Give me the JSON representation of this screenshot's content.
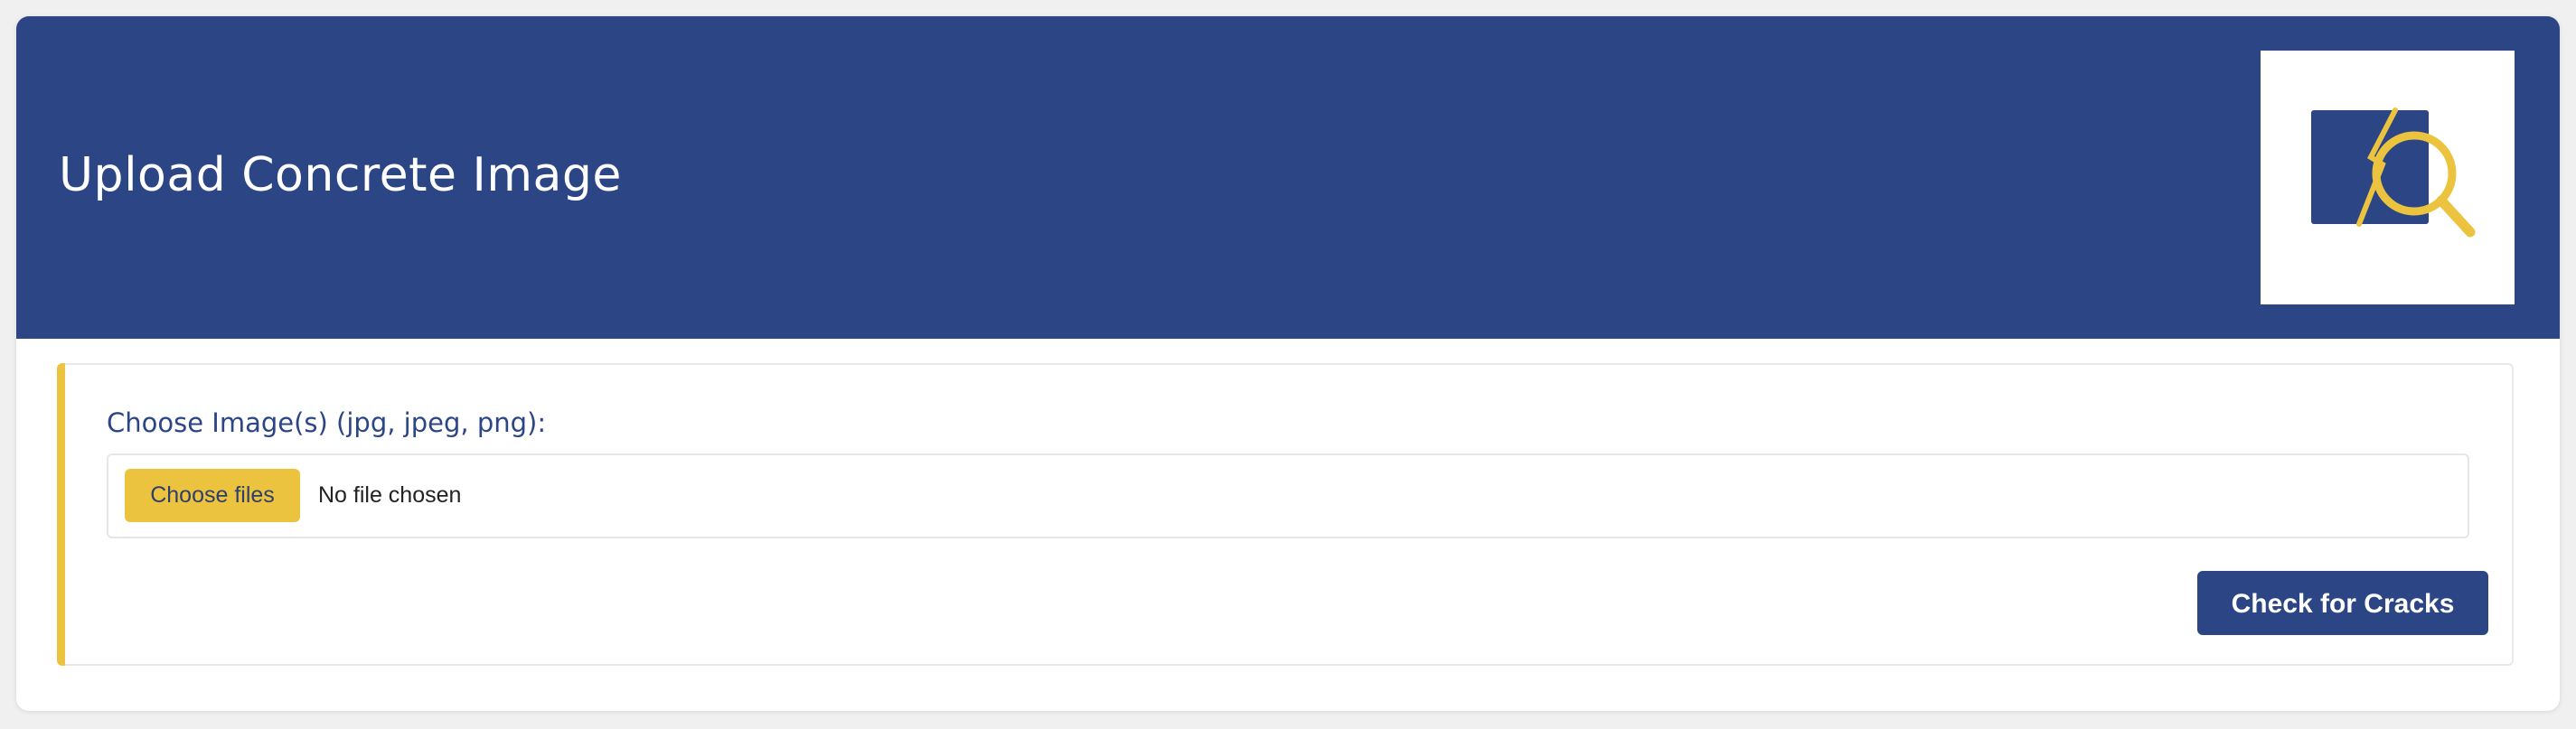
{
  "header": {
    "title": "Upload Concrete Image",
    "logo_icon": "crack-magnifier-icon"
  },
  "upload": {
    "label": "Choose Image(s) (jpg, jpeg, png):",
    "choose_button": "Choose files",
    "file_status": "No file chosen",
    "submit_button": "Check for Cracks"
  },
  "colors": {
    "primary": "#2c4685",
    "accent": "#ecc33e",
    "page_background": "#f0f0f1"
  }
}
